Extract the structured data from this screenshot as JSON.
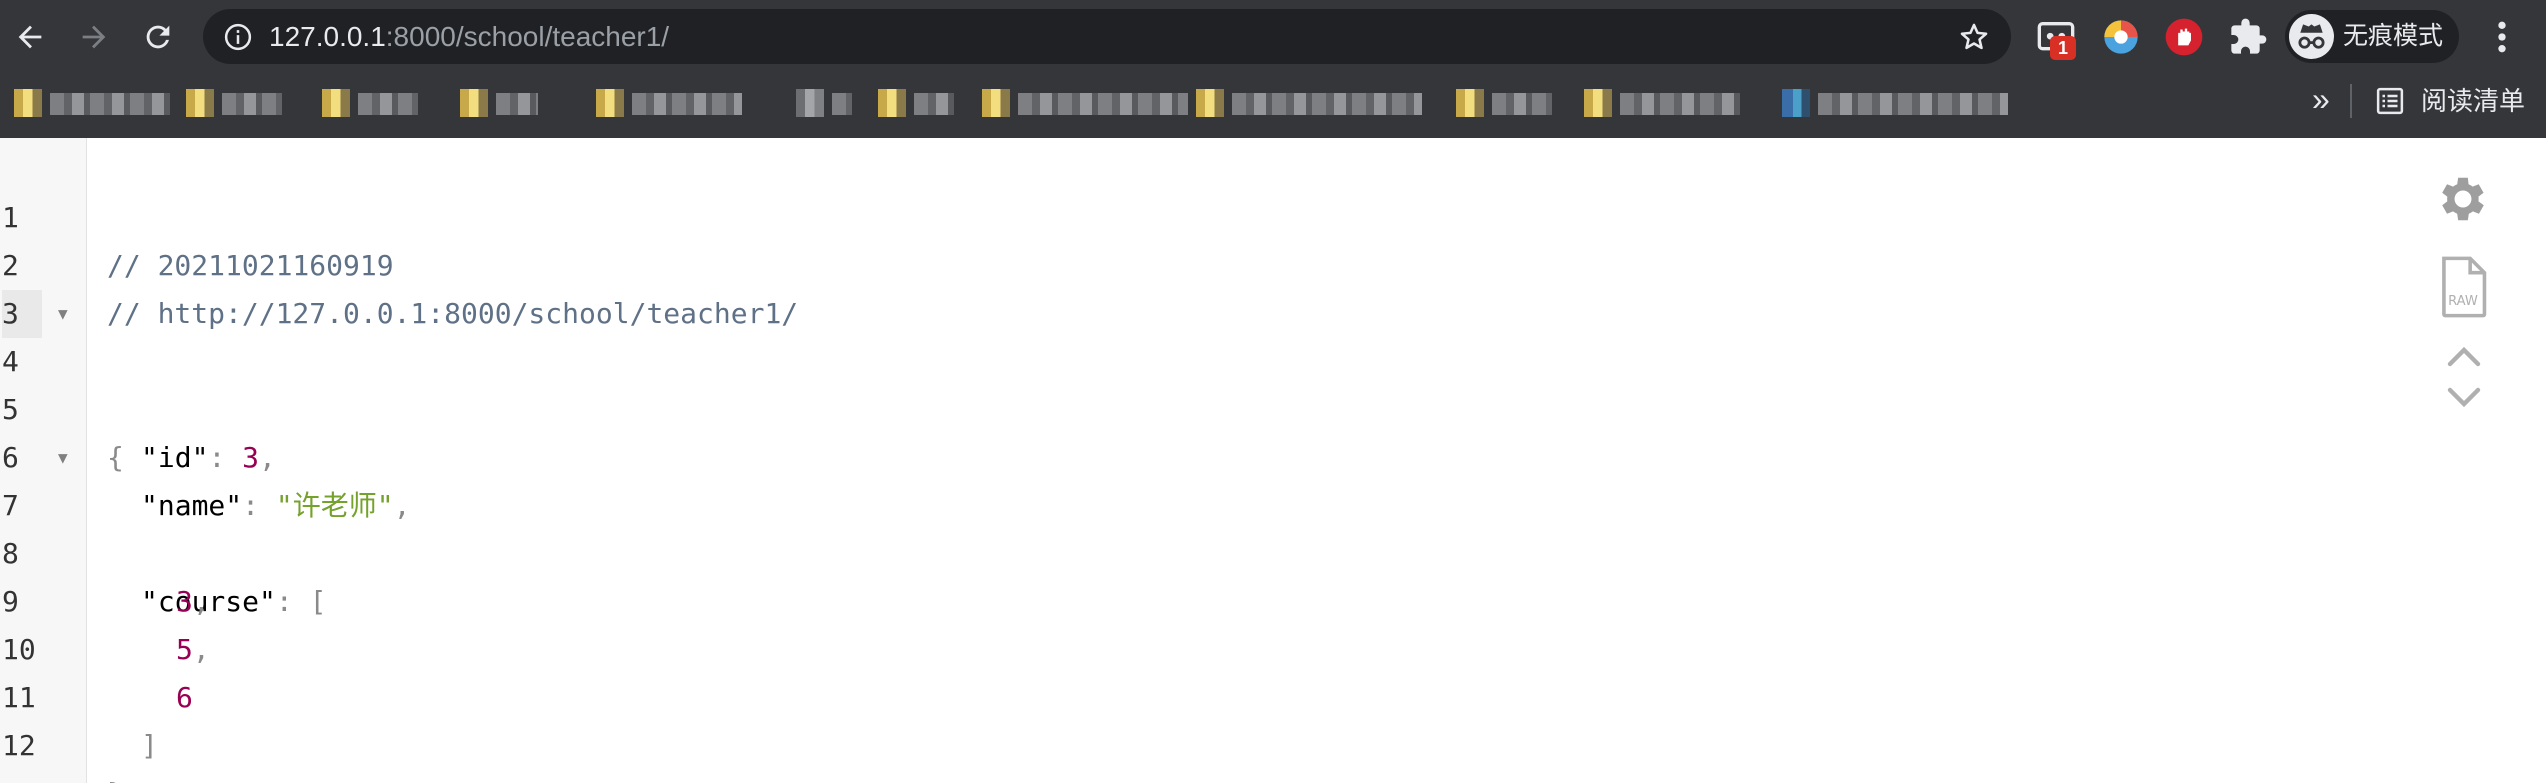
{
  "browser": {
    "url_host": "127.0.0.1",
    "url_rest": ":8000/school/teacher1/",
    "extension_badge": "1",
    "profile_label": "无痕模式",
    "bookmarks_overflow": "»",
    "reading_list_label": "阅读清单",
    "icons": {
      "back": "arrow-left-icon",
      "forward": "arrow-right-icon",
      "reload": "reload-icon",
      "site_info": "info-icon",
      "bookmark": "star-icon",
      "extensions": "puzzle-icon",
      "menu": "kebab-menu-icon"
    }
  },
  "viewer": {
    "lines": [
      {
        "n": "1",
        "comment": "// 20211021160919"
      },
      {
        "n": "2",
        "comment": "// http://127.0.0.1:8000/school/teacher1/"
      },
      {
        "n": "3"
      },
      {
        "n": "4",
        "open": "{"
      },
      {
        "n": "5",
        "key": "\"id\"",
        "colon": ":",
        "num": "3",
        "comma": ","
      },
      {
        "n": "6",
        "key": "\"name\"",
        "colon": ":",
        "str": "\"许老师\"",
        "comma": ","
      },
      {
        "n": "7",
        "key": "\"course\"",
        "colon": ":",
        "open": "["
      },
      {
        "n": "8",
        "num": "3",
        "comma": ","
      },
      {
        "n": "9",
        "num": "5",
        "comma": ","
      },
      {
        "n": "10",
        "num": "6"
      },
      {
        "n": "11",
        "close": "]"
      },
      {
        "n": "12",
        "close": "}"
      }
    ],
    "tools": {
      "settings": "gear-icon",
      "raw": "raw-file-icon",
      "raw_label": "RAW"
    }
  }
}
